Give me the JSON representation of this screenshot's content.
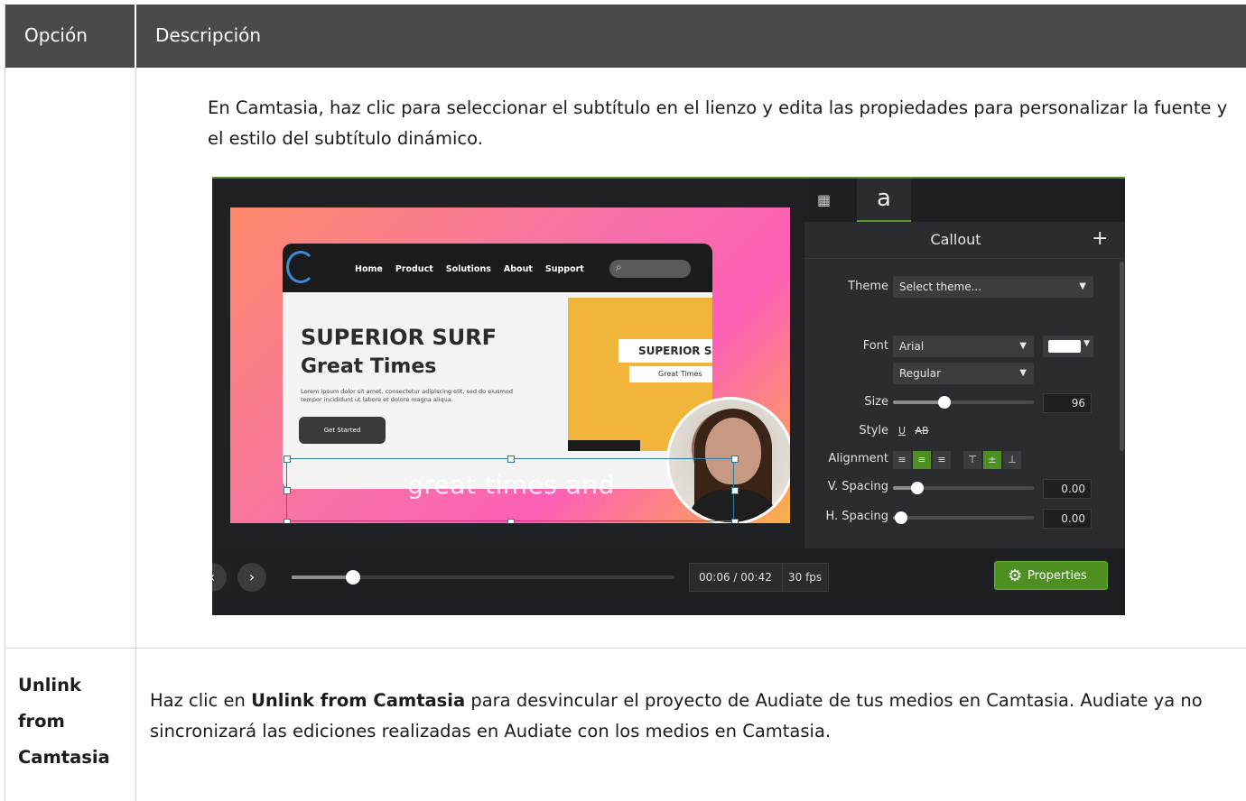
{
  "table": {
    "headers": [
      "Opción",
      "Descripción"
    ],
    "rows": [
      {
        "option": "",
        "description": "En Camtasia, haz clic para seleccionar el subtítulo en el lienzo y edita las propiedades para personalizar la fuente y el estilo del subtítulo dinámico."
      },
      {
        "option": "Unlink from Camtasia",
        "description_before": "Haz clic en ",
        "description_bold": "Unlink from Camtasia",
        "description_after": " para desvincular el proyecto de Audiate de tus medios en Camtasia. Audiate ya no sincronizará las ediciones realizadas en Audiate con los medios en Camtasia."
      }
    ]
  },
  "screenshot": {
    "website": {
      "nav": [
        "Home",
        "Product",
        "Solutions",
        "About",
        "Support"
      ],
      "hero_title": "SUPERIOR SURF",
      "hero_subtitle": "Great Times",
      "lorem": "Lorem ipsum dolor sit amet, consectetur adipiscing elit, sed do eiusmod tempor incididunt ut labore et dolore magna aliqua.",
      "cta": "Get Started",
      "card_title": "SUPERIOR SU",
      "card_subtitle": "Great Times"
    },
    "caption_text": "great times and",
    "panel": {
      "tab_a": "a",
      "title": "Callout",
      "theme_label": "Theme",
      "theme_value": "Select theme...",
      "font_label": "Font",
      "font_value": "Arial",
      "weight_value": "Regular",
      "size_label": "Size",
      "size_value": "96",
      "style_label": "Style",
      "alignment_label": "Alignment",
      "vspacing_label": "V. Spacing",
      "vspacing_value": "0.00",
      "hspacing_label": "H. Spacing",
      "hspacing_value": "0.00",
      "text_color": "#ffffff"
    },
    "timeline": {
      "time": "00:06 / 00:42",
      "fps": "30 fps",
      "progress": 0.16,
      "properties_label": "Properties"
    }
  }
}
